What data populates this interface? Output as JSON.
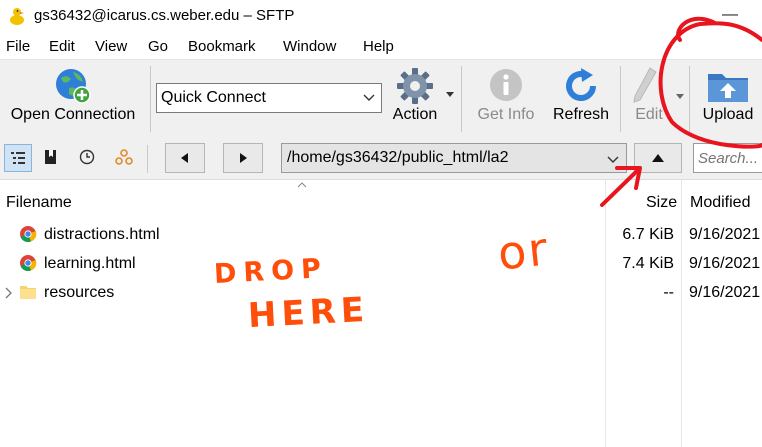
{
  "window": {
    "title": "gs36432@icarus.cs.weber.edu – SFTP",
    "minimize_glyph": "—"
  },
  "menu": [
    "File",
    "Edit",
    "View",
    "Go",
    "Bookmark",
    "Window",
    "Help"
  ],
  "toolbar": {
    "open_connection": "Open Connection",
    "quick_connect": "Quick Connect",
    "action": "Action",
    "get_info": "Get Info",
    "refresh": "Refresh",
    "edit": "Edit",
    "upload": "Upload"
  },
  "navigation": {
    "path": "/home/gs36432/public_html/la2",
    "search_placeholder": "Search..."
  },
  "columns": {
    "filename": "Filename",
    "size": "Size",
    "modified": "Modified"
  },
  "files": [
    {
      "name": "distractions.html",
      "size": "6.7 KiB",
      "modified": "9/16/2021",
      "icon": "chrome-html-icon"
    },
    {
      "name": "learning.html",
      "size": "7.4 KiB",
      "modified": "9/16/2021",
      "icon": "chrome-html-icon"
    },
    {
      "name": "resources",
      "size": "--",
      "modified": "9/16/2021",
      "icon": "folder-icon"
    }
  ],
  "annotations": {
    "drop": "DROP",
    "here": "HERE",
    "or": "or"
  },
  "colors": {
    "annotation": "#ff4d0a",
    "circle": "#e8141e",
    "toolbar_bg": "#f0f0f0"
  }
}
